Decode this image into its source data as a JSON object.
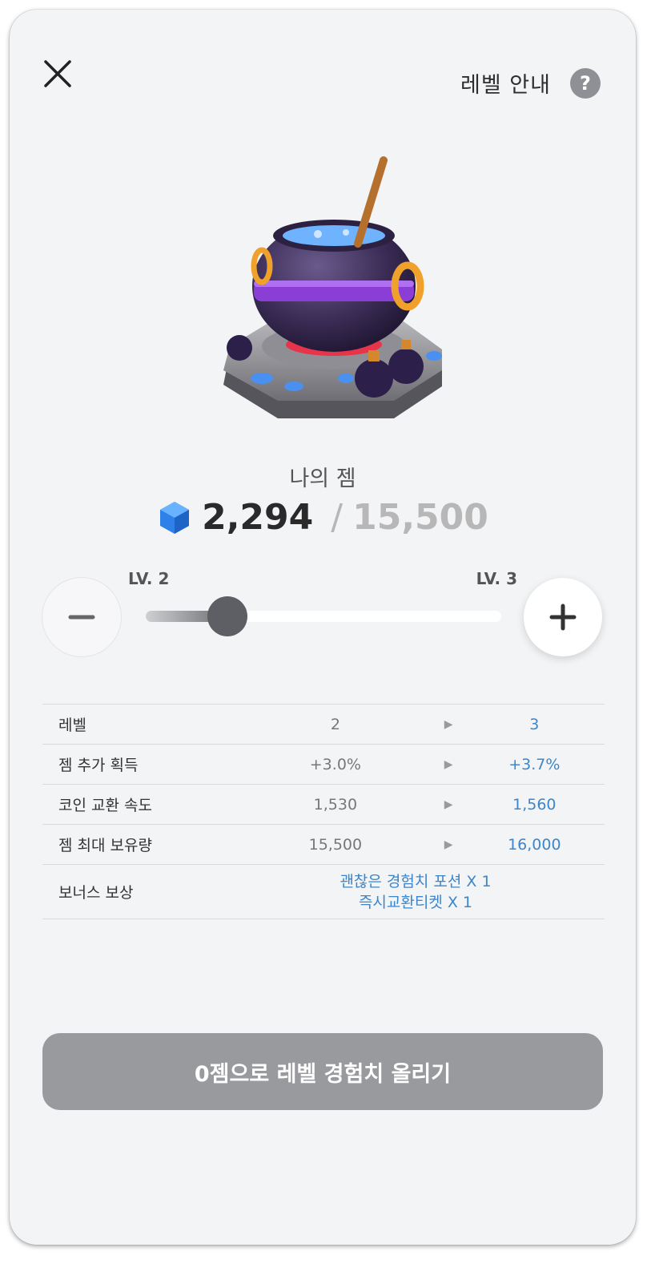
{
  "header": {
    "close_icon": "close-icon",
    "level_guide_label": "레벨 안내",
    "help_icon_text": "?"
  },
  "gem": {
    "label": "나의 젬",
    "current": "2,294",
    "separator": "/",
    "max": "15,500"
  },
  "level": {
    "current_label": "LV. 2",
    "next_label": "LV. 3",
    "minus_symbol": "−",
    "plus_symbol": "+",
    "slider_progress": 0.23
  },
  "stats": {
    "arrow": "▶",
    "rows": [
      {
        "name": "레벨",
        "from": "2",
        "to": "3"
      },
      {
        "name": "젬 추가 획득",
        "from": "+3.0%",
        "to": "+3.7%"
      },
      {
        "name": "코인 교환 속도",
        "from": "1,530",
        "to": "1,560"
      },
      {
        "name": "젬 최대 보유량",
        "from": "15,500",
        "to": "16,000"
      }
    ],
    "bonus": {
      "name": "보너스 보상",
      "items": [
        "괜찮은 경험치 포션 X 1",
        "즉시교환티켓 X 1"
      ]
    }
  },
  "cta": {
    "label": "0젬으로 레벨 경험치 올리기"
  },
  "colors": {
    "accent_blue": "#3c86c9",
    "button_gray": "#999a9e",
    "background": "#f3f4f6"
  }
}
